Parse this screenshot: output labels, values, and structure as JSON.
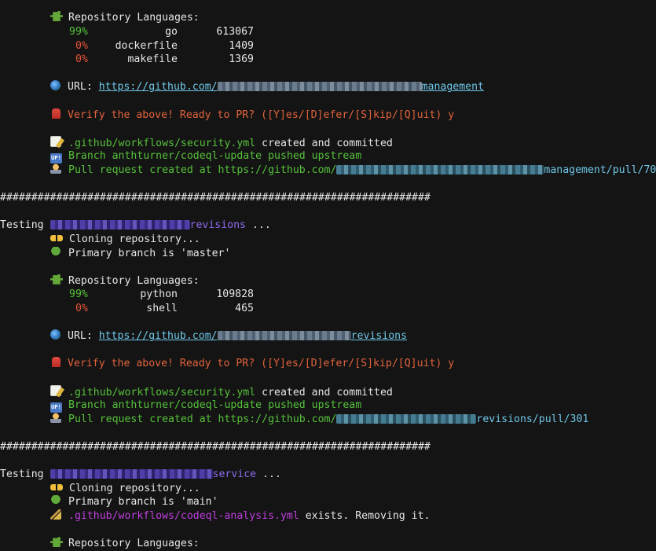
{
  "blocks": {
    "first": {
      "languages_label": "Repository Languages:",
      "languages": [
        {
          "pct": "99%",
          "lang": "go",
          "bytes": "613067",
          "color": "#56c23b"
        },
        {
          "pct": "0%",
          "lang": "dockerfile",
          "bytes": "1409",
          "color": "#e4533a"
        },
        {
          "pct": "0%",
          "lang": "makefile",
          "bytes": "1369",
          "color": "#e4533a"
        }
      ],
      "url_label": "URL:",
      "url_prefix": "https://github.com/",
      "url_suffix": "management",
      "verify": "Verify the above! Ready to PR? ([Y]es/[D]efer/[S]kip/[Q]uit) y",
      "workflow_file": ".github/workflows/security.yml",
      "workflow_msg": " created and committed",
      "branch_msg": "Branch anthturner/codeql-update pushed upstream",
      "pr_prefix": "Pull request created at https://github.com/",
      "pr_suffix": "management/pull/70"
    },
    "separator1": "#####################################################################",
    "second": {
      "testing_label": "Testing ",
      "repo_suffix": "revisions",
      "ellipsis": " ...",
      "cloning": "Cloning repository...",
      "primary_branch": "Primary branch is 'master'",
      "languages_label": "Repository Languages:",
      "languages": [
        {
          "pct": "99%",
          "lang": "python",
          "bytes": "109828",
          "color": "#56c23b"
        },
        {
          "pct": "0%",
          "lang": "shell",
          "bytes": "465",
          "color": "#e4533a"
        }
      ],
      "url_label": "URL:",
      "url_prefix": "https://github.com/",
      "url_suffix": "revisions",
      "verify": "Verify the above! Ready to PR? ([Y]es/[D]efer/[S]kip/[Q]uit) y",
      "workflow_file": ".github/workflows/security.yml",
      "workflow_msg": " created and committed",
      "branch_msg": "Branch anthturner/codeql-update pushed upstream",
      "pr_prefix": "Pull request created at https://github.com/",
      "pr_suffix": "revisions/pull/301"
    },
    "separator2": "#####################################################################",
    "third": {
      "testing_label": "Testing ",
      "repo_suffix": "service",
      "ellipsis": " ...",
      "cloning": "Cloning repository...",
      "primary_branch": "Primary branch is 'main'",
      "existing_file": ".github/workflows/codeql-analysis.yml",
      "existing_msg": " exists. Removing it.",
      "languages_label": "Repository Languages:"
    }
  }
}
